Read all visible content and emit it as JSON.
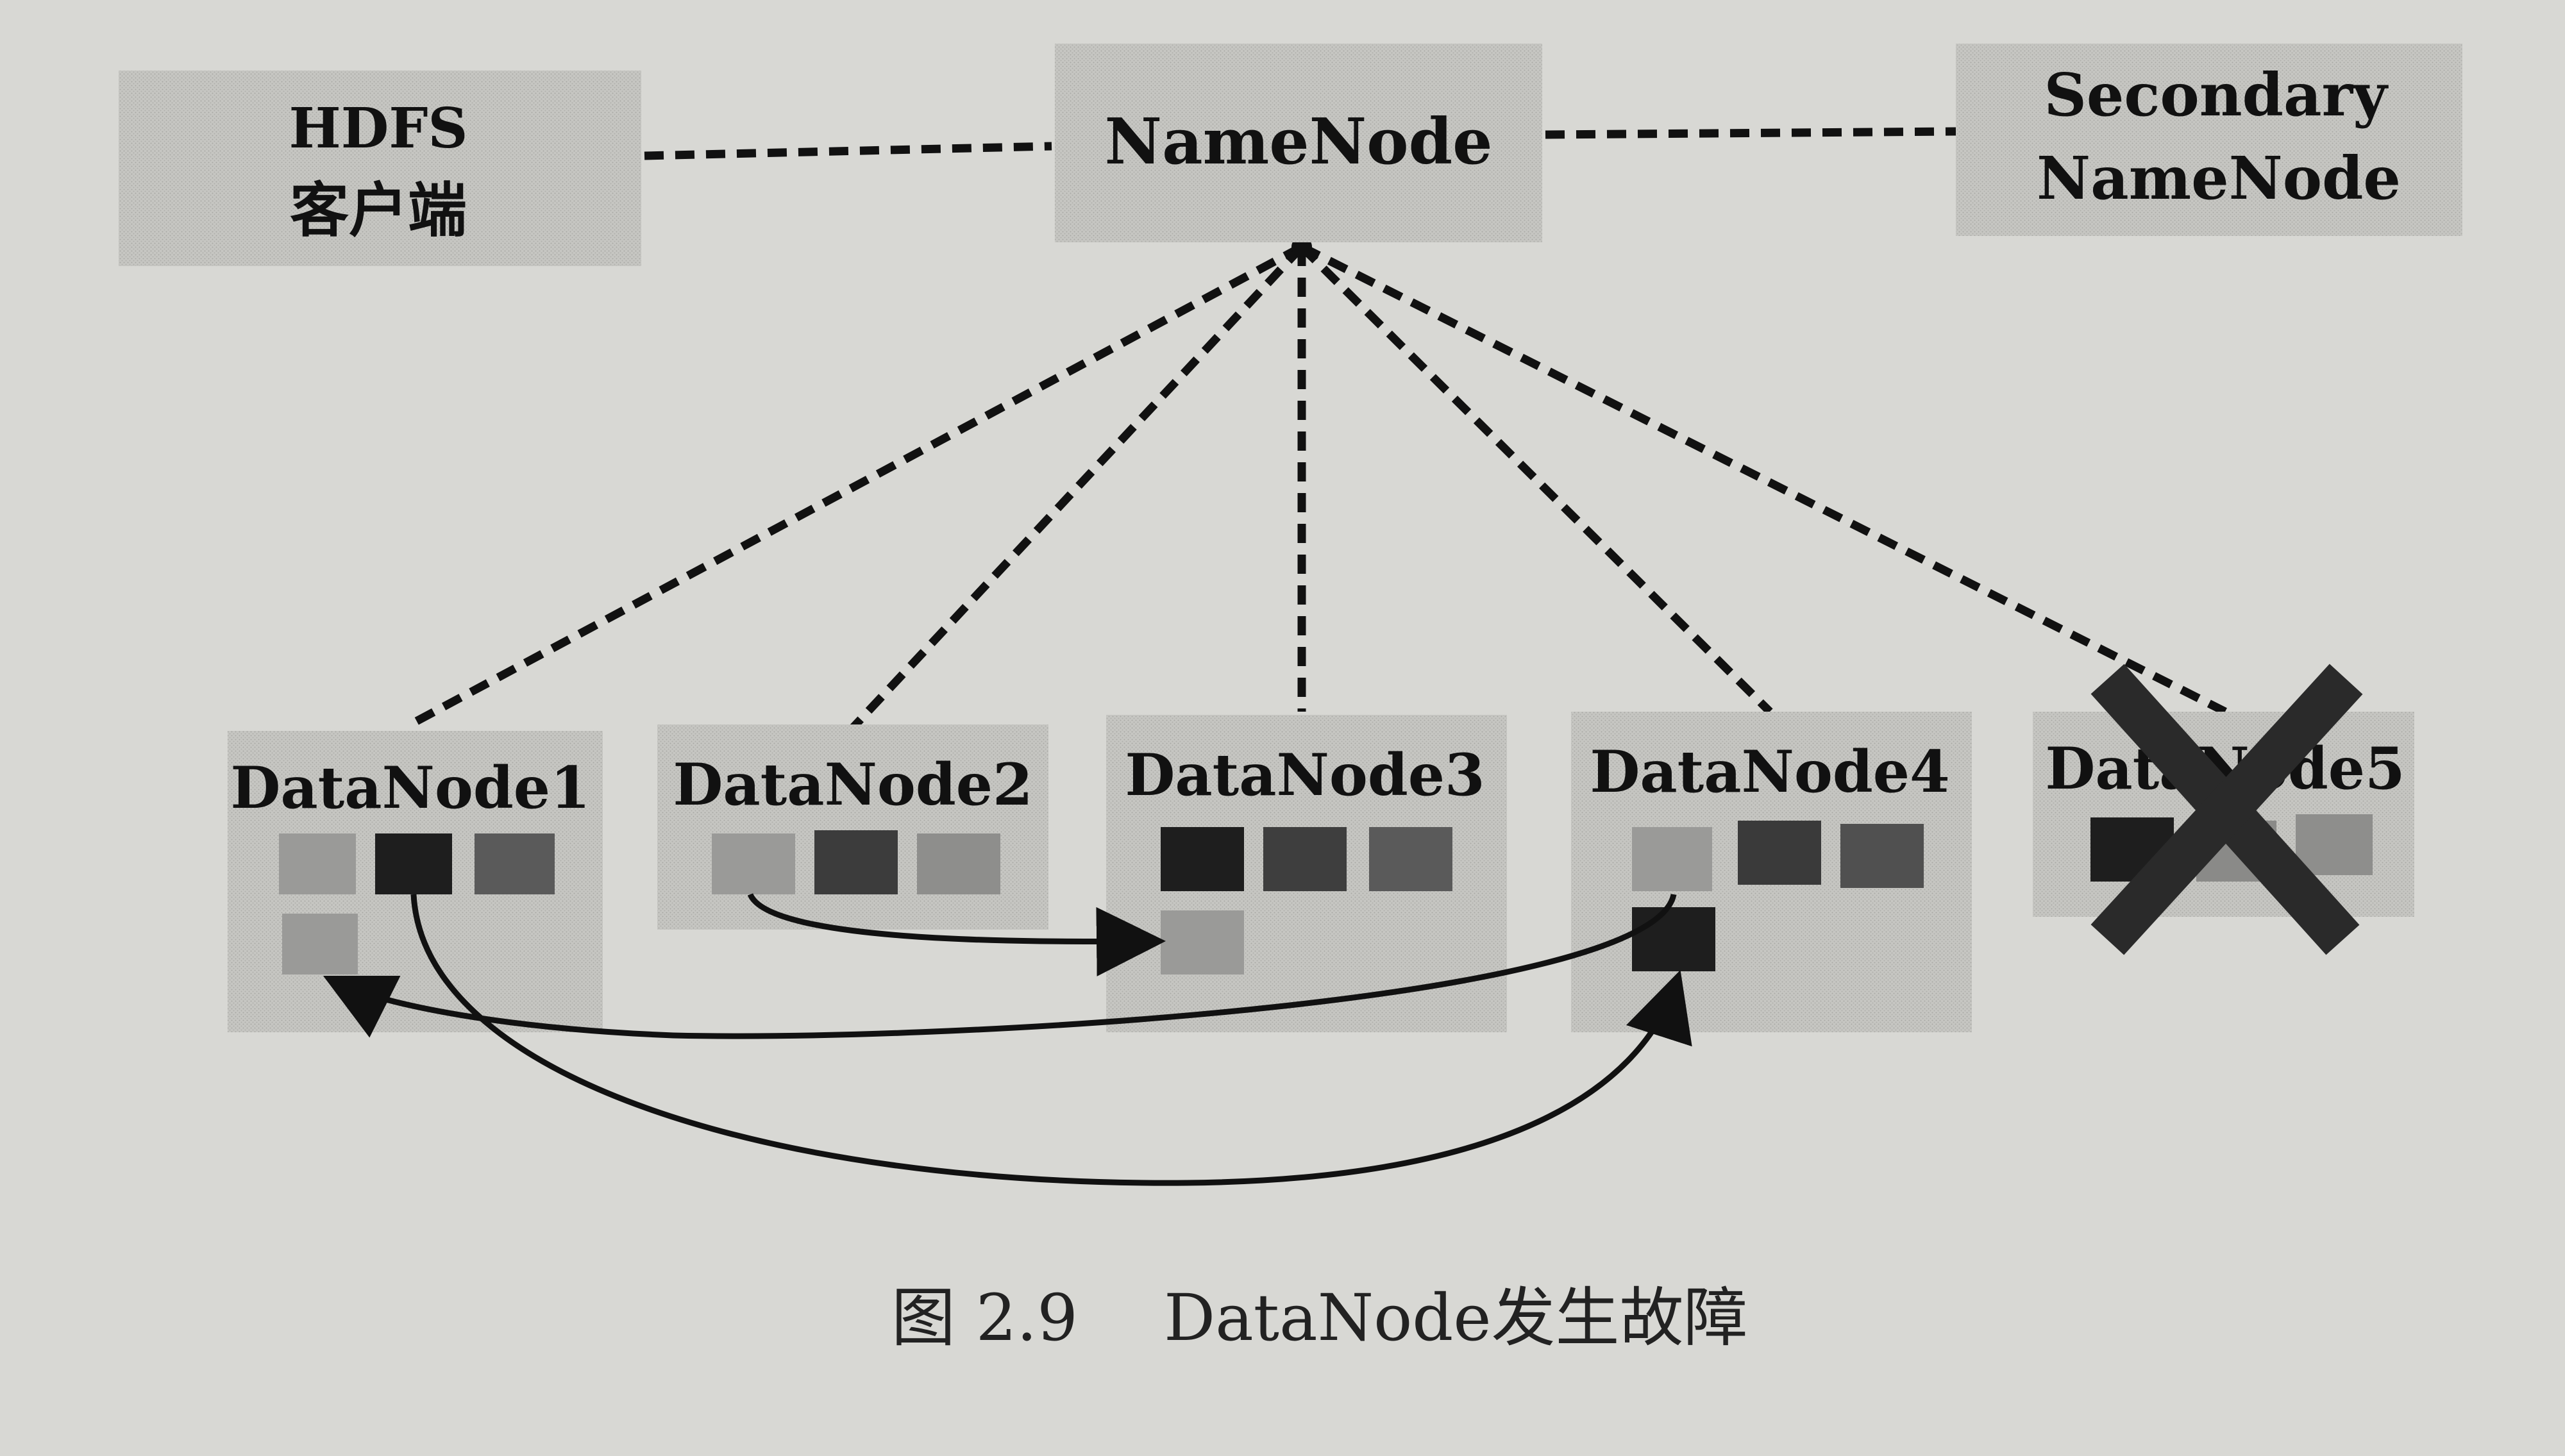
{
  "client": {
    "line1": "HDFS",
    "line2": "客户端"
  },
  "namenode": {
    "label": "NameNode"
  },
  "secondary": {
    "line1": "Secondary",
    "line2": "NameNode"
  },
  "datanodes": [
    {
      "label": "DataNode1"
    },
    {
      "label": "DataNode2"
    },
    {
      "label": "DataNode3"
    },
    {
      "label": "DataNode4"
    },
    {
      "label": "DataNode5"
    }
  ],
  "caption": {
    "figure_number": "图 2.9",
    "text": "DataNode发生故障"
  },
  "colors": {
    "background": "#d8d8d4",
    "box_fill": "#c4c4c0",
    "block_light": "#9a9a98",
    "block_mid": "#5a5a5a",
    "block_dark": "#1e1e1e",
    "line": "#111111",
    "cross": "#2a2a2a"
  }
}
